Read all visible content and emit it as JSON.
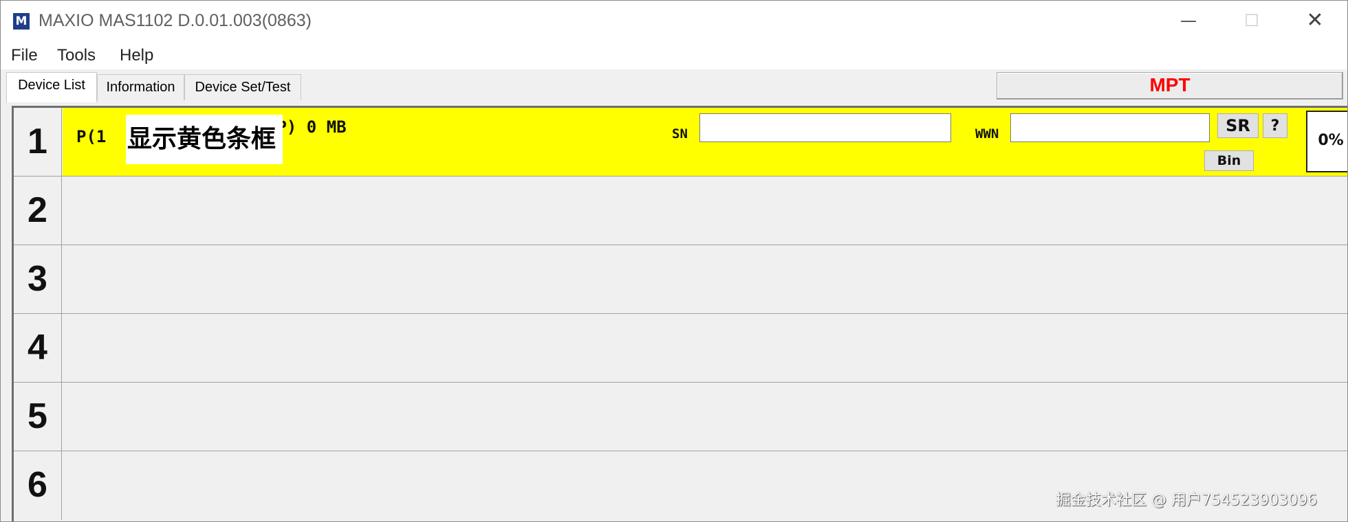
{
  "window": {
    "app_icon_letter": "M",
    "title": "MAXIO MAS1102 D.0.01.003(0863)",
    "minimize_glyph": "—",
    "maximize_glyph": "☐",
    "close_glyph": "✕"
  },
  "menu": {
    "items": [
      "File",
      "Tools",
      "Help"
    ]
  },
  "tabs": [
    {
      "label": "Device List",
      "active": true
    },
    {
      "label": "Information",
      "active": false
    },
    {
      "label": "Device Set/Test",
      "active": false
    }
  ],
  "mode_label": "MPT",
  "devices": [
    {
      "number": "1",
      "highlight": "#ffff00",
      "label_left": "P(1",
      "label_right": "DP)  0 MB",
      "overlay_text": "显示黄色条框",
      "sn_label": "SN",
      "sn_value": "",
      "wwn_label": "WWN",
      "wwn_value": "",
      "sr_button": "SR",
      "help_button": "?",
      "bin_button": "Bin",
      "progress_text": "0%",
      "progress": 0
    },
    {
      "number": "2"
    },
    {
      "number": "3"
    },
    {
      "number": "4"
    },
    {
      "number": "5"
    },
    {
      "number": "6"
    }
  ],
  "watermark": "掘金技术社区 @ 用户754523903096",
  "colors": {
    "mode_label": "#ff0000",
    "active_row": "#ffff00",
    "app_icon_bg": "#1f3d8c"
  }
}
